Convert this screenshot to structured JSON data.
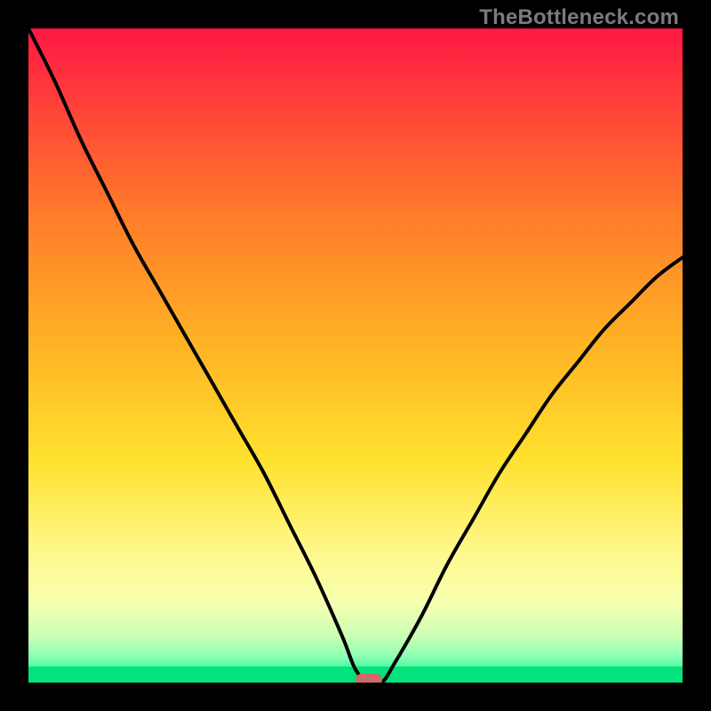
{
  "watermark": "TheBottleneck.com",
  "chart_data": {
    "type": "line",
    "title": "",
    "xlabel": "",
    "ylabel": "",
    "xlim": [
      0,
      100
    ],
    "ylim": [
      0,
      100
    ],
    "grid": false,
    "legend": false,
    "gradient": {
      "description": "Vertical background gradient from red (top) through orange, yellow, pale-yellow, pale-green to bright green (bottom).",
      "stops": [
        {
          "offset": 0.0,
          "color": "#ff1744"
        },
        {
          "offset": 0.1,
          "color": "#ff3b3b"
        },
        {
          "offset": 0.28,
          "color": "#ff7a2a"
        },
        {
          "offset": 0.48,
          "color": "#ffb224"
        },
        {
          "offset": 0.66,
          "color": "#ffe12e"
        },
        {
          "offset": 0.8,
          "color": "#fff98c"
        },
        {
          "offset": 0.88,
          "color": "#f6ffb0"
        },
        {
          "offset": 0.93,
          "color": "#c9ffb4"
        },
        {
          "offset": 0.96,
          "color": "#8dffb4"
        },
        {
          "offset": 0.985,
          "color": "#2bf79a"
        },
        {
          "offset": 1.0,
          "color": "#04e37c"
        }
      ]
    },
    "series": [
      {
        "name": "bottleneck-curve",
        "description": "Black V-shaped curve. Enters top-left, drops steeply toward x≈52 at the bottom, short flat minimum, then rises smoothly to upper right. Represents bottleneck percentage vs component balance; minimum = best match.",
        "x": [
          0,
          4,
          8,
          12,
          16,
          20,
          24,
          28,
          32,
          36,
          40,
          44,
          48,
          50,
          52,
          54,
          56,
          60,
          64,
          68,
          72,
          76,
          80,
          84,
          88,
          92,
          96,
          100
        ],
        "y": [
          100,
          92,
          83,
          75,
          67,
          60,
          53,
          46,
          39,
          32,
          24,
          16,
          7,
          2,
          0,
          0,
          3,
          10,
          18,
          25,
          32,
          38,
          44,
          49,
          54,
          58,
          62,
          65
        ]
      }
    ],
    "marker": {
      "description": "Rounded reddish-pink marker at the curve's minimum on the green band.",
      "x": 52,
      "y": 0,
      "color": "#cf6a6a"
    },
    "bottom_band": {
      "description": "Solid bright green strip along the very bottom inside the plot area.",
      "color": "#04e37c"
    }
  }
}
